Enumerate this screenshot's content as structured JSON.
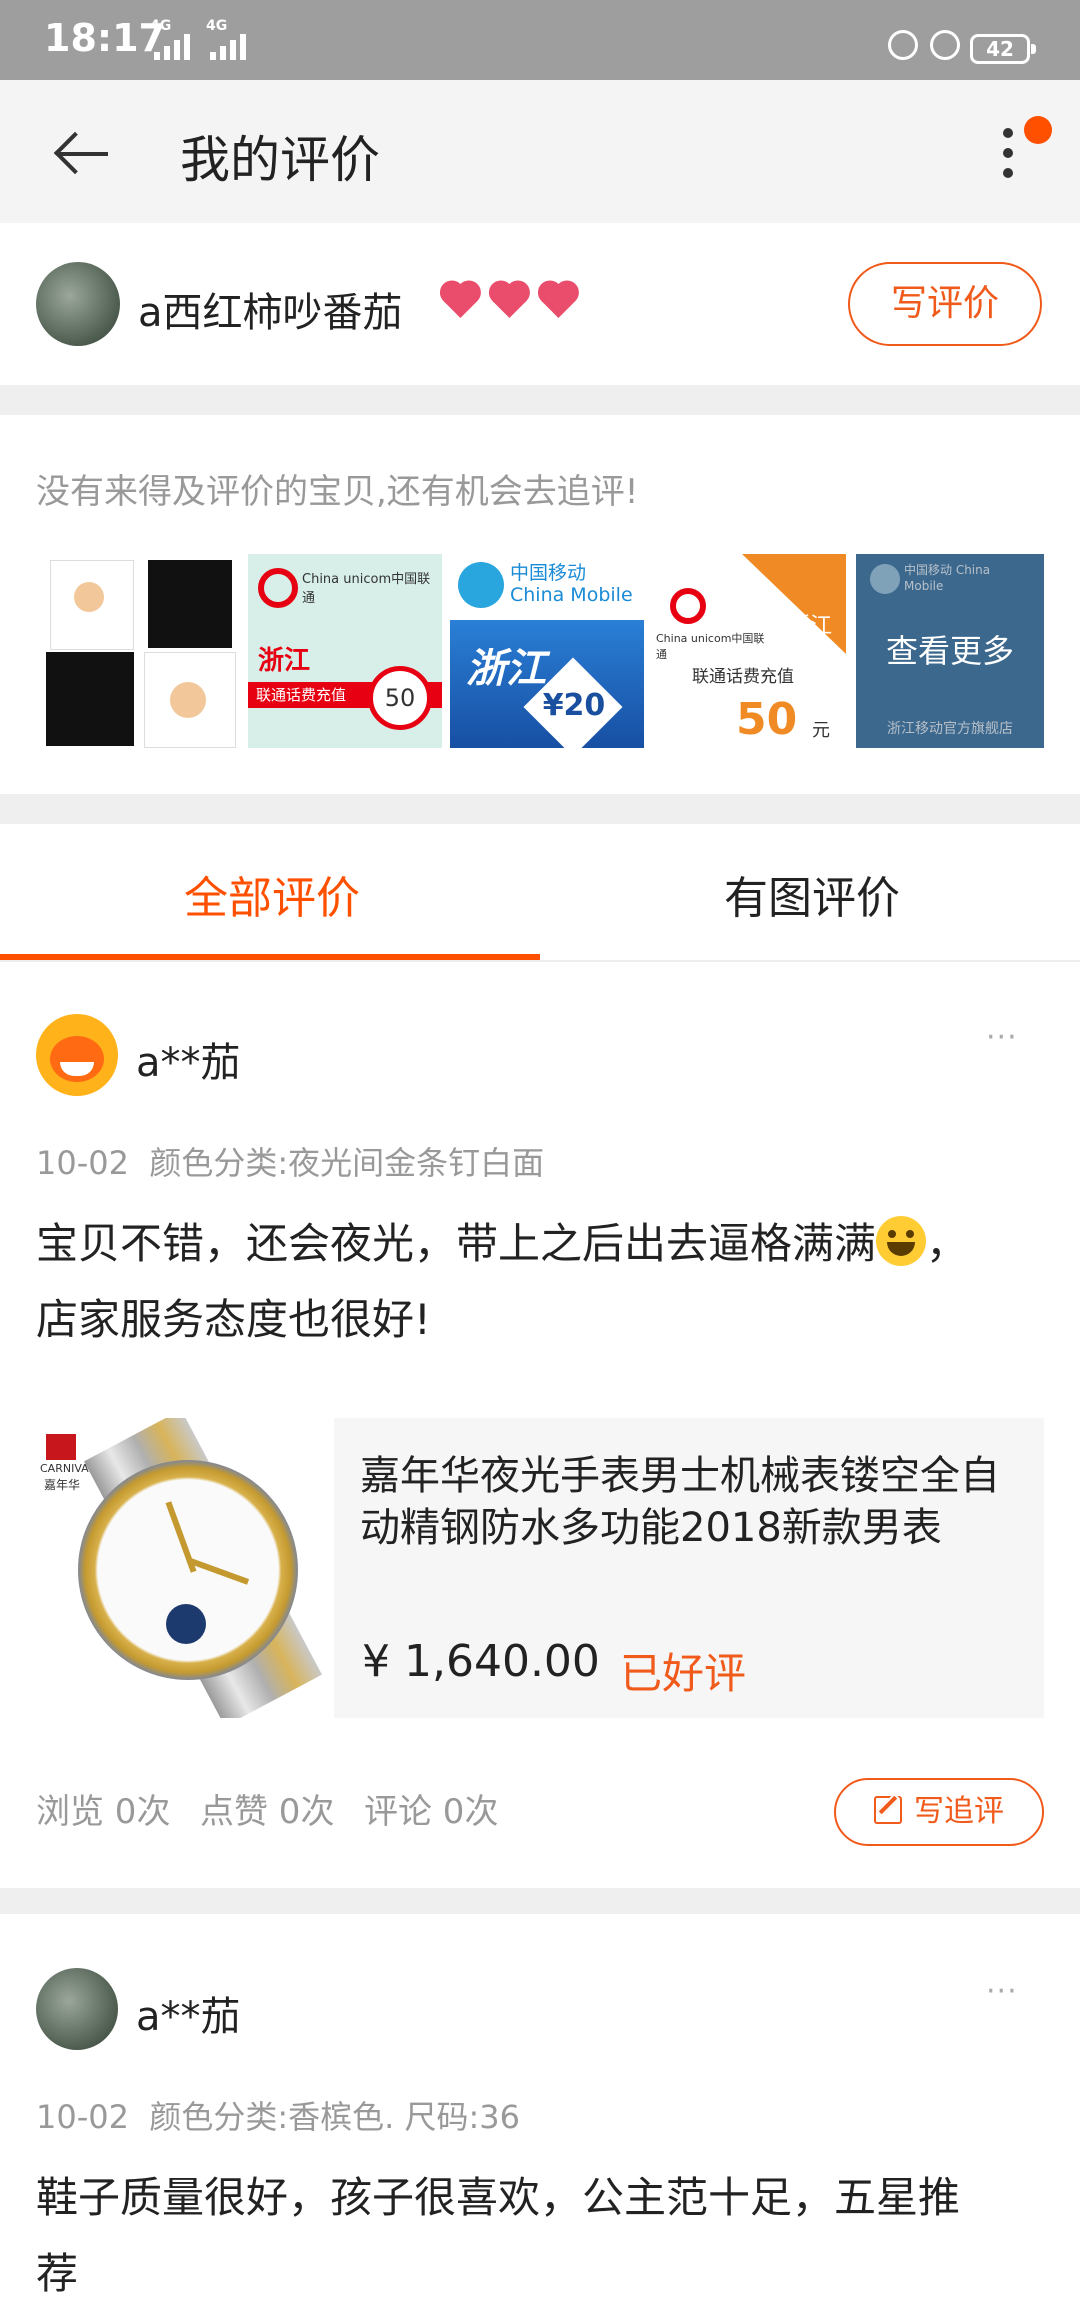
{
  "status_bar": {
    "time": "18:17",
    "signal1_label": "4G",
    "signal2_label": "4G",
    "battery": "42"
  },
  "nav": {
    "title": "我的评价"
  },
  "user": {
    "name": "a西红柿吵番茄",
    "write_review_label": "写评价"
  },
  "pending": {
    "hint": "没有来得及评价的宝贝,还有机会去追评!",
    "see_more_label": "查看更多",
    "items": [
      {
        "name": "t-shirts",
        "text": ""
      },
      {
        "name": "unicom-zhejiang-50",
        "brand": "China unicom中国联通",
        "region": "浙江",
        "caption": "联通话费充值",
        "amount": "50"
      },
      {
        "name": "mobile-zhejiang-20",
        "brand": "中国移动 China Mobile",
        "region": "浙江",
        "amount": "¥20"
      },
      {
        "name": "unicom-zhejiang-50b",
        "brand": "China unicom中国联通",
        "region": "浙江",
        "caption": "联通话费充值",
        "amount": "50",
        "unit": "元"
      },
      {
        "name": "mobile-store",
        "brand": "中国移动 China Mobile",
        "caption": "浙江移动官方旗舰店"
      }
    ]
  },
  "tabs": [
    {
      "label": "全部评价",
      "active": true
    },
    {
      "label": "有图评价",
      "active": false
    }
  ],
  "reviews": [
    {
      "author": "a**茄",
      "more": "···",
      "date": "10-02",
      "spec": "颜色分类:夜光间金条钉白面",
      "text_part1": "宝贝不错，还会夜光，带上之后出去逼格满满",
      "text_part2": "，",
      "text_line2": "店家服务态度也很好!",
      "product": {
        "title": "嘉年华夜光手表男士机械表镂空全自动精钢防水多功能2018新款男表",
        "price": "¥ 1,640.00",
        "status": "已好评",
        "brand_en": "CARNIVAL",
        "brand_cn": "嘉年华"
      },
      "stats": {
        "views": "浏览 0次",
        "likes": "点赞 0次",
        "comments": "评论 0次"
      },
      "follow_label": "写追评"
    },
    {
      "author": "a**茄",
      "more": "···",
      "date": "10-02",
      "spec": "颜色分类:香槟色. 尺码:36",
      "text_line1": "鞋子质量很好，孩子很喜欢，公主范十足，五星推",
      "text_line2": "荐"
    }
  ],
  "colors": {
    "accent": "#ff5000",
    "button_border": "#f05a1a",
    "muted_text": "#999999",
    "status_bar": "#9e9e9e",
    "nav_bar": "#f4f4f4"
  }
}
